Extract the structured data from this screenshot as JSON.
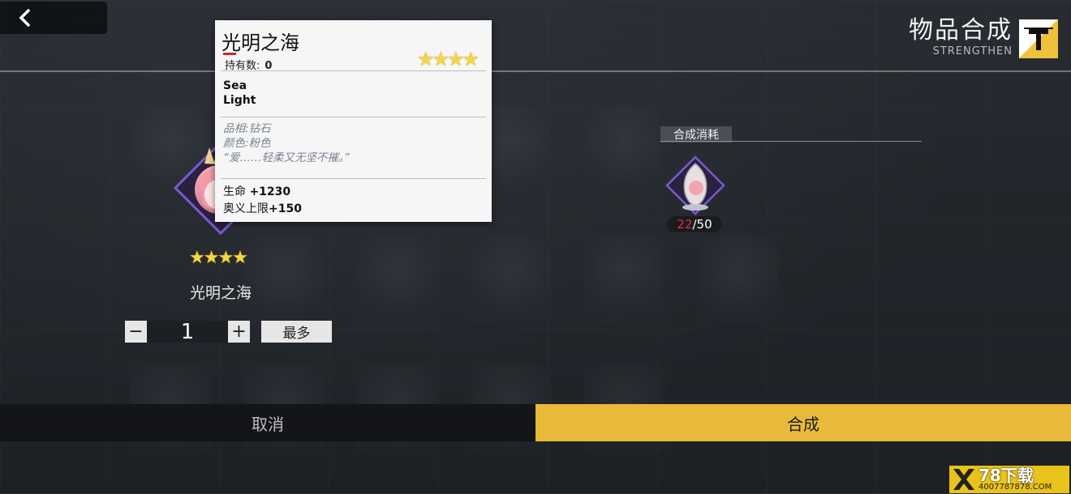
{
  "header": {
    "title": "物品合成",
    "subtitle": "STRENGTHEN"
  },
  "tooltip": {
    "name": "光明之海",
    "hold_label": "持有数:",
    "hold_count": "0",
    "stars": "★★★★",
    "english_name_line1": "Sea",
    "english_name_line2": "Light",
    "desc_line1": "品相:钻石",
    "desc_line2": "颜色:粉色",
    "desc_line3": "“爱……轻柔又无坚不摧。”",
    "stat1_label": "生命",
    "stat1_value": "+1230",
    "stat2_label": "奥义上限",
    "stat2_value": "+150"
  },
  "item": {
    "stars": "★★★★",
    "name": "光明之海"
  },
  "stepper": {
    "minus": "−",
    "value": "1",
    "plus": "+",
    "max_label": "最多"
  },
  "cost": {
    "label": "合成消耗",
    "have": "22",
    "need": "/50"
  },
  "bottom": {
    "cancel_label": "取消",
    "confirm_label": "合成"
  },
  "watermark": {
    "line1": "78下载",
    "line2": "4007787878.COM"
  },
  "colors": {
    "accent": "#e9b93a",
    "star": "#f5d64a",
    "deficit": "#e23030",
    "frame": "#6a4bb8"
  },
  "icons": {
    "back": "chevron-left-icon",
    "title": "hammer-icon",
    "watermark": "x-logo-icon"
  }
}
